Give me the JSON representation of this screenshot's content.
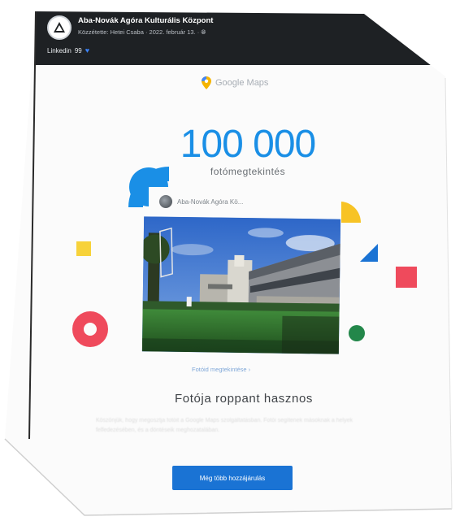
{
  "post": {
    "page_name": "Aba-Novák Agóra Kulturális Központ",
    "meta": "Közzétette: Hetei Csaba  ·  2022. február 13.  ·",
    "reactions_count": "Linkedin",
    "reactions_suffix": "99"
  },
  "card": {
    "brand": "Google Maps",
    "big_number": "100 000",
    "metric_label": "fotómegtekintés",
    "author": "Aba-Novák Agóra Kö...",
    "link_label": "Fotóid megtekintése  ›",
    "heading": "Fotója roppant hasznos",
    "body_text": "Köszönjük, hogy megosztja fotóit a Google Maps szolgáltatásban. Fotói segítenek másoknak a helyek felfedezésében, és a döntéseik meghozatalában.",
    "button_label": "Még több hozzájárulás"
  },
  "colors": {
    "accent_blue": "#1a8fe6",
    "button_blue": "#1a73d4",
    "header_dark": "#1e2124",
    "shape_red": "#ef4a5c",
    "shape_yellow": "#f7c325",
    "shape_green": "#23874a"
  },
  "icons": {
    "avatar": "agora-logo-icon",
    "brand": "google-maps-pin-icon",
    "reaction": "heart-icon",
    "globe": "globe-icon"
  }
}
